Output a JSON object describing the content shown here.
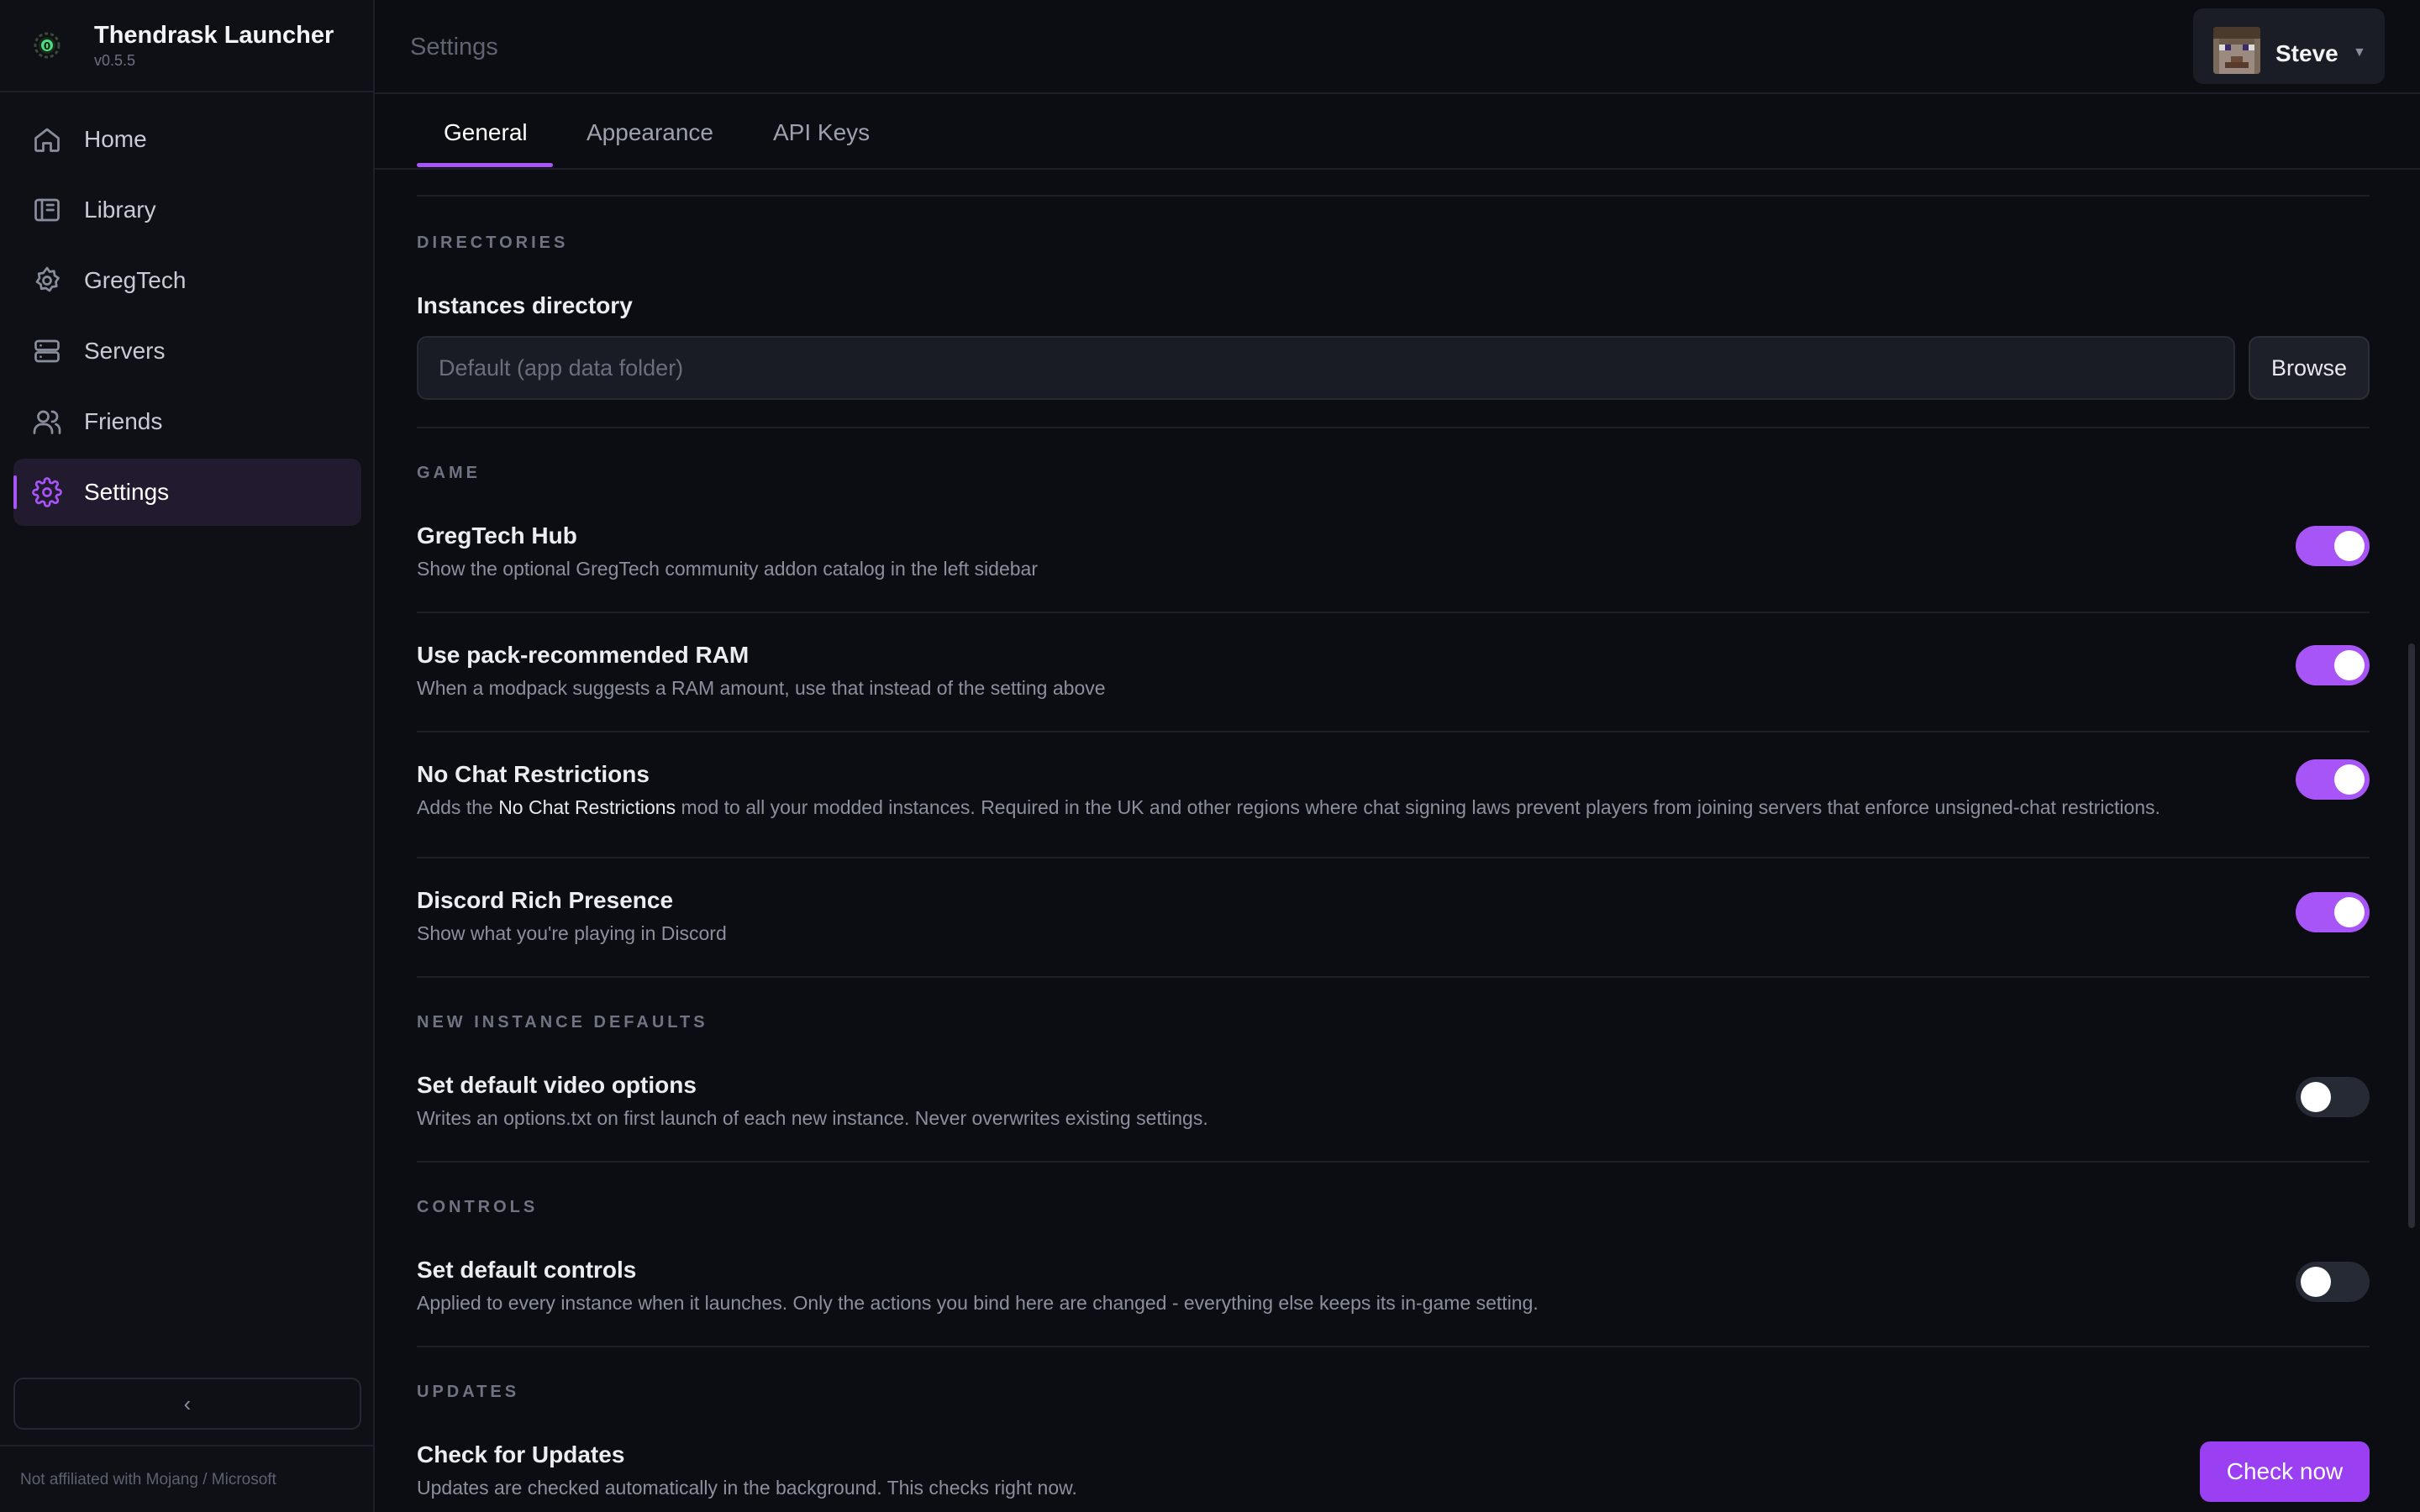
{
  "app": {
    "name": "Thendrask Launcher",
    "version": "v0.5.5",
    "disclaimer": "Not affiliated with Mojang / Microsoft",
    "accent_color": "#a855f7"
  },
  "sidebar": {
    "items": [
      {
        "label": "Home",
        "icon": "home-icon",
        "active": false
      },
      {
        "label": "Library",
        "icon": "library-icon",
        "active": false
      },
      {
        "label": "GregTech",
        "icon": "gregtech-gear-icon",
        "active": false
      },
      {
        "label": "Servers",
        "icon": "server-icon",
        "active": false
      },
      {
        "label": "Friends",
        "icon": "users-icon",
        "active": false
      },
      {
        "label": "Settings",
        "icon": "settings-gear-icon",
        "active": true
      }
    ],
    "collapse_icon": "chevron-left-icon"
  },
  "header": {
    "title": "Settings",
    "user": {
      "name": "Steve",
      "avatar": "steve-skin-head-avatar"
    }
  },
  "tabs": [
    {
      "label": "General",
      "active": true
    },
    {
      "label": "Appearance",
      "active": false
    },
    {
      "label": "API Keys",
      "active": false
    }
  ],
  "sections": {
    "directories": {
      "heading": "DIRECTORIES",
      "instances_label": "Instances directory",
      "instances_placeholder": "Default (app data folder)",
      "instances_value": "",
      "browse_label": "Browse"
    },
    "game": {
      "heading": "GAME",
      "settings": [
        {
          "name": "GregTech Hub",
          "desc": "Show the optional GregTech community addon catalog in the left sidebar",
          "enabled": true
        },
        {
          "name": "Use pack-recommended RAM",
          "desc": "When a modpack suggests a RAM amount, use that instead of the setting above",
          "enabled": true
        },
        {
          "name": "No Chat Restrictions",
          "desc_before": "Adds the ",
          "desc_highlight": "No Chat Restrictions",
          "desc_after": " mod to all your modded instances. Required in the UK and other regions where chat signing laws prevent players from joining servers that enforce unsigned-chat restrictions.",
          "enabled": true
        },
        {
          "name": "Discord Rich Presence",
          "desc": "Show what you're playing in Discord",
          "enabled": true
        }
      ]
    },
    "new_instance_defaults": {
      "heading": "NEW INSTANCE DEFAULTS",
      "settings": [
        {
          "name": "Set default video options",
          "desc": "Writes an options.txt on first launch of each new instance. Never overwrites existing settings.",
          "enabled": false
        }
      ]
    },
    "controls": {
      "heading": "CONTROLS",
      "settings": [
        {
          "name": "Set default controls",
          "desc": "Applied to every instance when it launches. Only the actions you bind here are changed - everything else keeps its in-game setting.",
          "enabled": false
        }
      ]
    },
    "updates": {
      "heading": "UPDATES",
      "name": "Check for Updates",
      "desc": "Updates are checked automatically in the background. This checks right now.",
      "button_label": "Check now"
    }
  }
}
